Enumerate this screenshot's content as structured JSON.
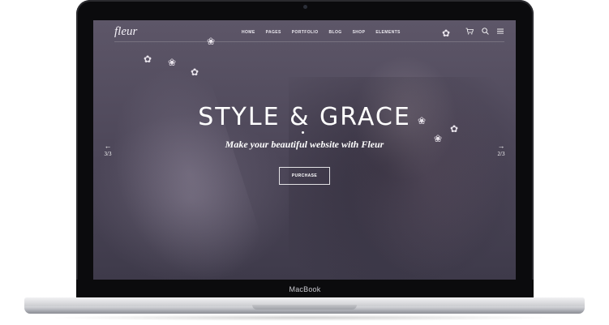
{
  "device": {
    "label": "MacBook"
  },
  "site": {
    "logo": "fleur",
    "nav": [
      "HOME",
      "PAGES",
      "PORTFOLIO",
      "BLOG",
      "SHOP",
      "ELEMENTS"
    ]
  },
  "icons": {
    "cart": "cart-icon",
    "search": "search-icon",
    "menu": "menu-icon"
  },
  "hero": {
    "title": "STYLE & GRACE",
    "subtitle": "Make your beautiful website with Fleur",
    "button": "PURCHASE",
    "prev_count": "3/3",
    "next_count": "2/3"
  },
  "colors": {
    "overlay": "#4c4658",
    "text": "#ffffff"
  }
}
